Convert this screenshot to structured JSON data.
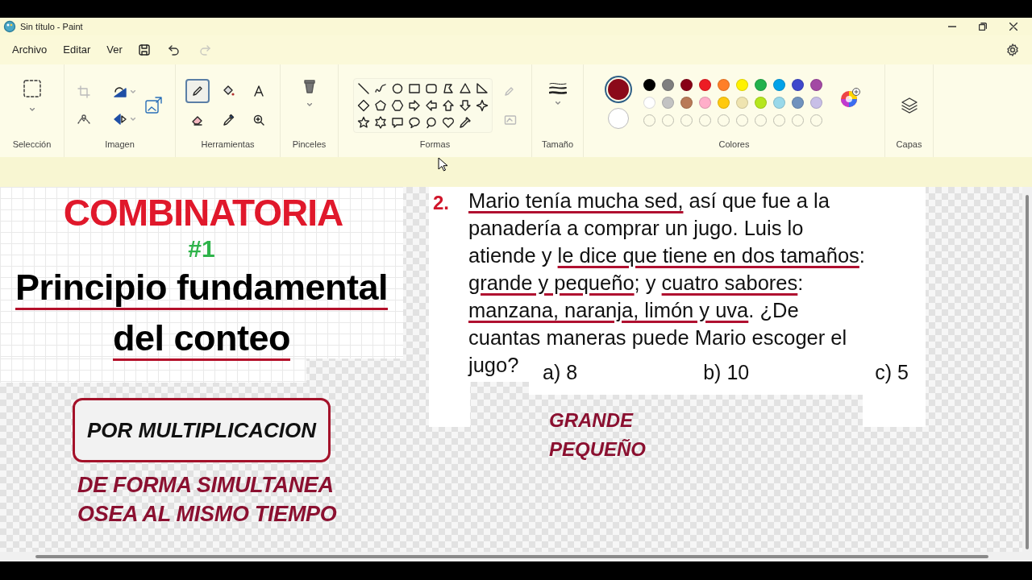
{
  "window": {
    "title": "Sin título - Paint"
  },
  "menu": [
    "Archivo",
    "Editar",
    "Ver"
  ],
  "history": {
    "undo_enabled": true,
    "redo_enabled": false
  },
  "ribbon": {
    "groups": [
      {
        "kind": "selection",
        "label": "Selección"
      },
      {
        "kind": "image",
        "label": "Imagen"
      },
      {
        "kind": "tools",
        "label": "Herramientas"
      },
      {
        "kind": "brushes",
        "label": "Pinceles"
      },
      {
        "kind": "shapes",
        "label": "Formas"
      },
      {
        "kind": "size",
        "label": "Tamaño"
      },
      {
        "kind": "colors",
        "label": "Colores"
      },
      {
        "kind": "layers",
        "label": "Capas"
      }
    ],
    "tools": [
      {
        "kind": "pencil",
        "selected": true
      },
      {
        "kind": "fill",
        "selected": false
      },
      {
        "kind": "text",
        "selected": false
      },
      {
        "kind": "eraser",
        "selected": false
      },
      {
        "kind": "picker",
        "selected": false
      },
      {
        "kind": "magnifier",
        "selected": false
      }
    ],
    "active_colors": [
      {
        "color": "#8b0a1a",
        "selected": true
      },
      {
        "color": "#ffffff",
        "selected": false
      }
    ],
    "palette": [
      {
        "color": "#000000"
      },
      {
        "color": "#7f7f7f"
      },
      {
        "color": "#880015"
      },
      {
        "color": "#ed1c24"
      },
      {
        "color": "#ff7f27"
      },
      {
        "color": "#fff200"
      },
      {
        "color": "#22b14c"
      },
      {
        "color": "#00a2e8"
      },
      {
        "color": "#3f48cc"
      },
      {
        "color": "#a349a4"
      },
      {
        "color": "#ffffff"
      },
      {
        "color": "#c3c3c3"
      },
      {
        "color": "#b97a57"
      },
      {
        "color": "#ffaec9"
      },
      {
        "color": "#ffc90e"
      },
      {
        "color": "#efe4b0"
      },
      {
        "color": "#b5e61d"
      },
      {
        "color": "#99d9ea"
      },
      {
        "color": "#7092be"
      },
      {
        "color": "#c8bfe7"
      }
    ]
  },
  "canvas": {
    "title": "COMBINATORIA",
    "number": "#1",
    "subtitle_lines": [
      "Principio fundamental",
      "del conteo"
    ],
    "boxed_note": "POR MULTIPLICACION",
    "note_lines": [
      "DE FORMA SIMULTANEA",
      "OSEA AL MISMO TIEMPO"
    ],
    "problem": {
      "number": "2.",
      "lines": [
        [
          {
            "text": "Mario tenía mucha sed,",
            "underlined": true
          },
          {
            "text": " así que fue a la",
            "underlined": false
          }
        ],
        [
          {
            "text": "panadería a comprar un jugo. Luis lo",
            "underlined": false
          }
        ],
        [
          {
            "text": "atiende y ",
            "underlined": false
          },
          {
            "text": "le dice que tiene en dos tamaños",
            "underlined": true
          },
          {
            "text": ":",
            "underlined": false
          }
        ],
        [
          {
            "text": "grande y pequeño",
            "underlined": true
          },
          {
            "text": "; y ",
            "underlined": false
          },
          {
            "text": "cuatro sabores",
            "underlined": true
          },
          {
            "text": ":",
            "underlined": false
          }
        ],
        [
          {
            "text": "manzana, naranja, limón y uva",
            "underlined": true
          },
          {
            "text": ". ¿De",
            "underlined": false
          }
        ],
        [
          {
            "text": "cuantas maneras puede Mario escoger el",
            "underlined": false
          }
        ],
        [
          {
            "text": "jugo?",
            "underlined": false
          }
        ]
      ],
      "options": [
        "a) 8",
        "b) 10",
        "c) 5"
      ]
    },
    "answer_lines": [
      "GRANDE",
      "PEQUEÑO"
    ]
  }
}
